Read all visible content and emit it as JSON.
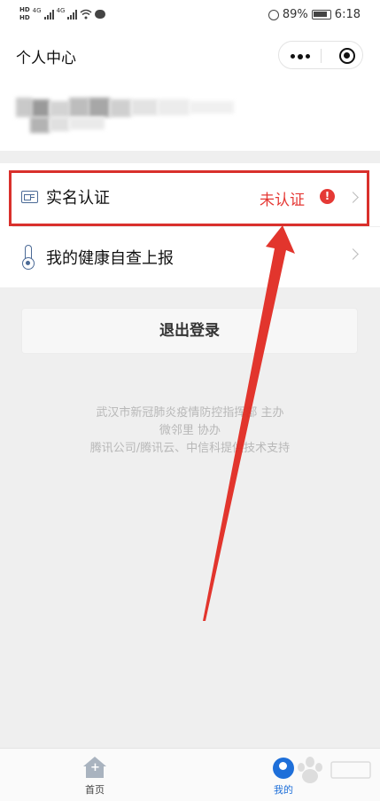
{
  "status_bar": {
    "hd_1": "HD",
    "hd_2": "HD",
    "net_1": "4G",
    "net_2": "4G",
    "battery_percent": "89%",
    "time": "6:18"
  },
  "nav": {
    "title": "个人中心"
  },
  "profile": {
    "name_blurred": true
  },
  "list": {
    "items": [
      {
        "label": "实名认证",
        "status": "未认证",
        "status_color": "#e53935",
        "icon": "id-card-icon"
      },
      {
        "label": "我的健康自查上报",
        "icon": "thermometer-icon"
      }
    ]
  },
  "logout": {
    "label": "退出登录"
  },
  "credits": {
    "line1": "武汉市新冠肺炎疫情防控指挥部 主办",
    "line2": "微邻里 协办",
    "line3": "腾讯公司/腾讯云、中信科提供技术支持"
  },
  "tabbar": {
    "home": "首页",
    "mine": "我的"
  },
  "colors": {
    "accent": "#1e6fd9",
    "annotation": "#d9302c",
    "warning": "#e53935"
  }
}
